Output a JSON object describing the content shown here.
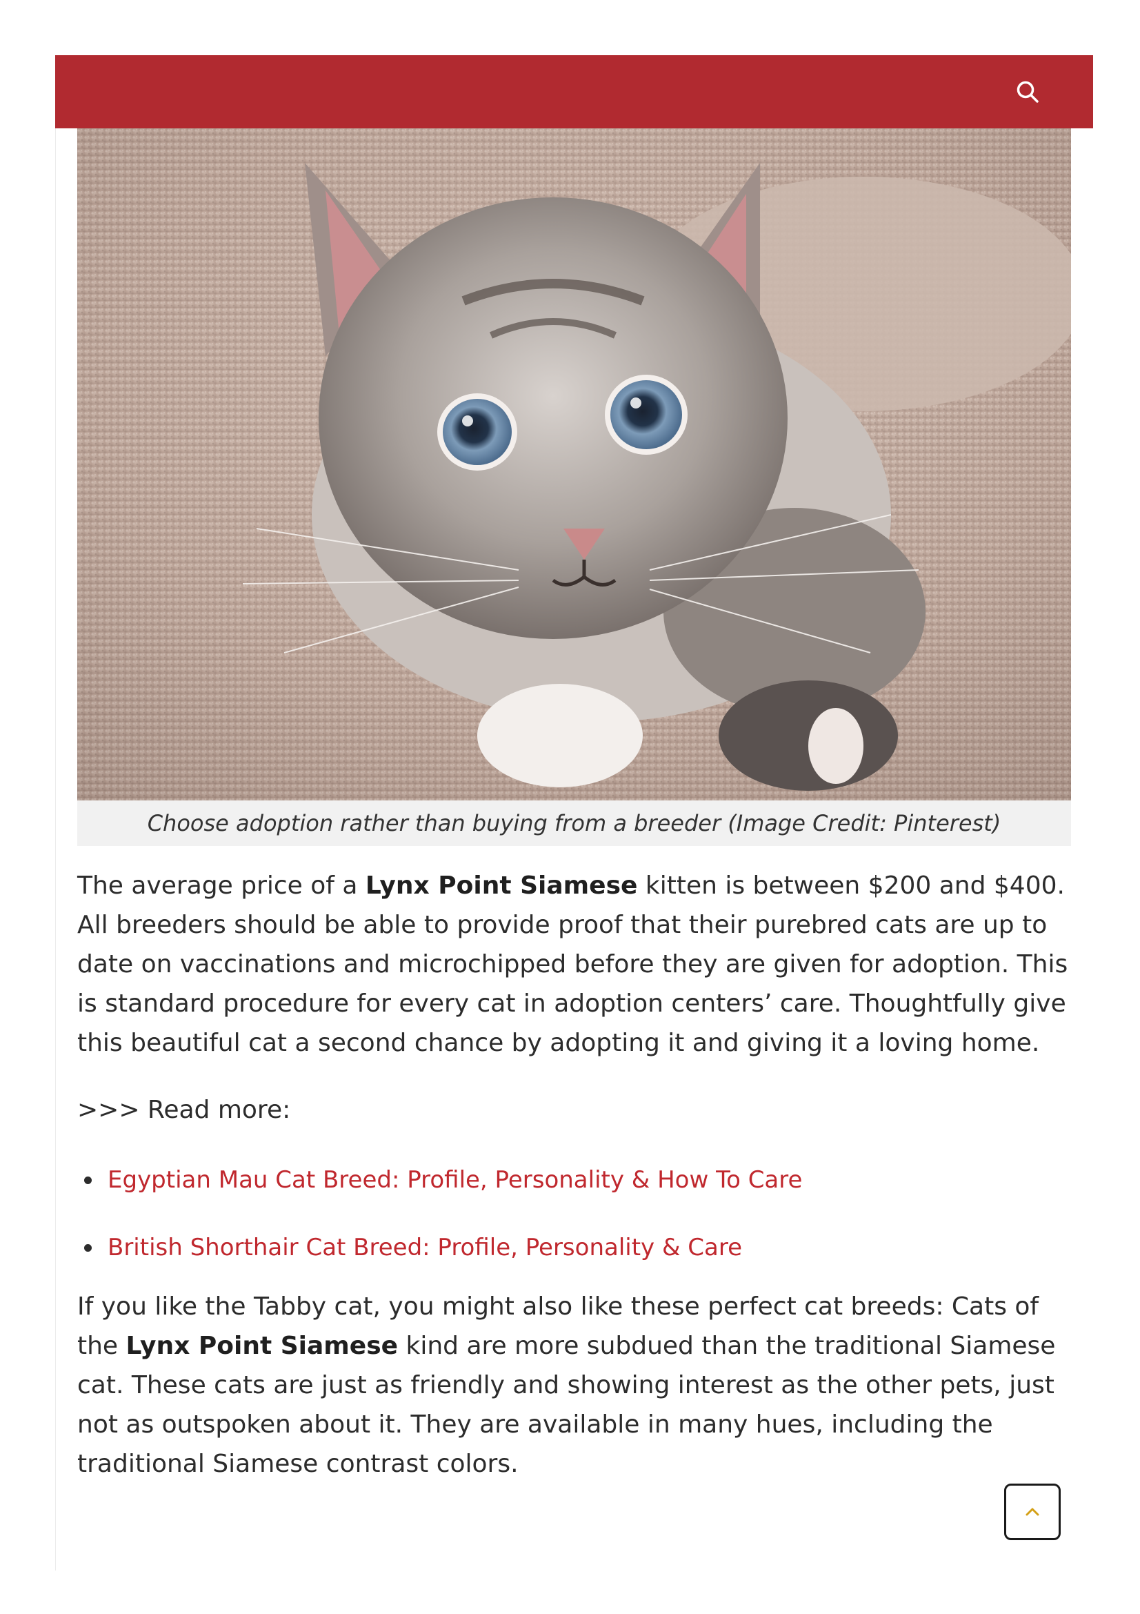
{
  "header": {
    "background_color": "#b12a30",
    "search_icon": "search-icon"
  },
  "figure": {
    "image_description_icon": "cat-photo",
    "caption": "Choose adoption rather than buying from a breeder (Image Credit: Pinterest)"
  },
  "article": {
    "p1_part1": "The average price of a ",
    "p1_bold": "Lynx Point Siamese",
    "p1_part2": " kitten is between $200 and $400. All breeders should be able to provide proof that their purebred cats are up to date on vaccinations and microchipped before they are given for adoption. This is standard procedure for every cat in adoption centers’ care. Thoughtfully give this beautiful cat a second chance by adopting it and giving it a loving home.",
    "read_more": ">>> Read more:",
    "related": [
      {
        "label": "Egyptian Mau Cat Breed: Profile, Personality & How To Care"
      },
      {
        "label": "British Shorthair Cat Breed: Profile, Personality & Care"
      }
    ],
    "p2_part1": "If you like the Tabby cat, you might also like these perfect cat breeds: Cats of the ",
    "p2_bold": "Lynx Point Siamese",
    "p2_part2": " kind are more subdued than the traditional Siamese cat. These cats are just as friendly and showing interest as the other pets, just not as outspoken about it. They are available in many hues, including the traditional Siamese contrast colors."
  },
  "colors": {
    "accent": "#b12a30",
    "link": "#c0282e",
    "caption_bg": "#f1f1f1",
    "back_to_top_arrow": "#d4a017"
  },
  "back_to_top_icon": "chevron-up-icon"
}
